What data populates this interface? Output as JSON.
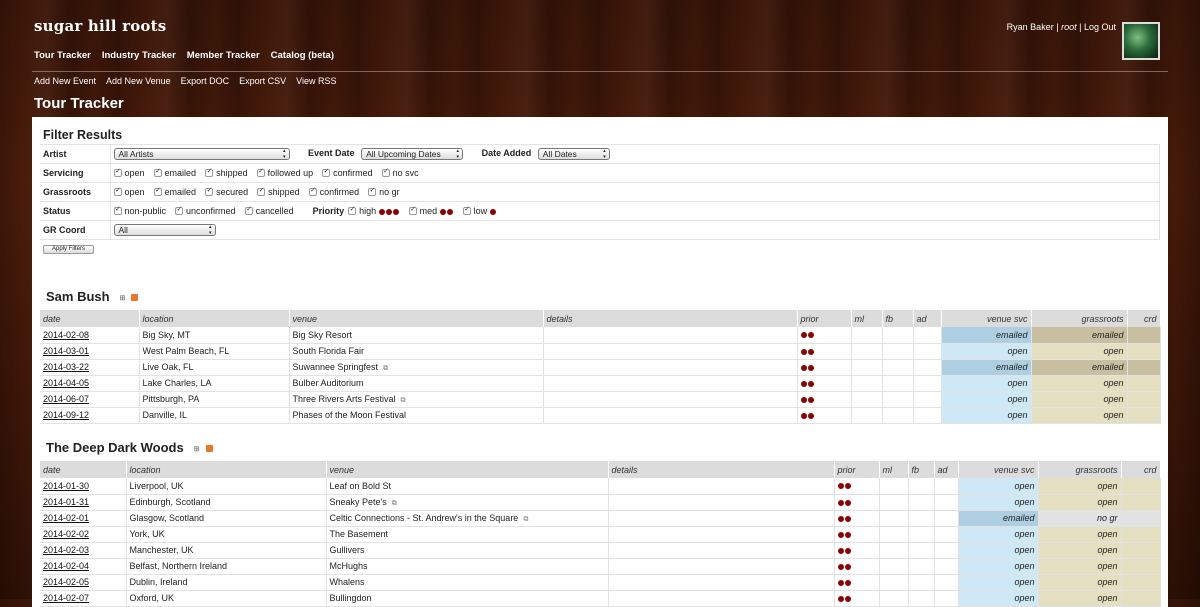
{
  "app": {
    "logo": "sugar hill roots",
    "user": {
      "name": "Ryan Baker",
      "sep1": "|",
      "role": "root",
      "sep2": "|",
      "logout": "Log Out"
    },
    "main_nav": [
      "Tour Tracker",
      "Industry Tracker",
      "Member Tracker",
      "Catalog (beta)"
    ],
    "sub_nav": [
      "Add New Event",
      "Add New Venue",
      "Export DOC",
      "Export CSV",
      "View RSS"
    ],
    "page_title": "Tour Tracker"
  },
  "filters": {
    "title": "Filter Results",
    "artist_label": "Artist",
    "artist_value": "All Artists",
    "event_date_label": "Event Date",
    "event_date_value": "All Upcoming Dates",
    "date_added_label": "Date Added",
    "date_added_value": "All Dates",
    "servicing_label": "Servicing",
    "servicing_options": [
      "open",
      "emailed",
      "shipped",
      "followed up",
      "confirmed",
      "no svc"
    ],
    "grassroots_label": "Grassroots",
    "grassroots_options": [
      "open",
      "emailed",
      "secured",
      "shipped",
      "confirmed",
      "no gr"
    ],
    "status_label": "Status",
    "status_options": [
      "non-public",
      "unconfirmed",
      "cancelled"
    ],
    "priority_label": "Priority",
    "priority_options": [
      {
        "label": "high",
        "dots": 3
      },
      {
        "label": "med",
        "dots": 2
      },
      {
        "label": "low",
        "dots": 1
      }
    ],
    "gr_coord_label": "GR Coord",
    "gr_coord_value": "All",
    "apply_label": "Apply Filters"
  },
  "columns": [
    "date",
    "location",
    "venue",
    "details",
    "prior",
    "ml",
    "fb",
    "ad",
    "venue svc",
    "grassroots",
    "crd"
  ],
  "artists": [
    {
      "name": "Sam Bush",
      "events": [
        {
          "date": "2014-02-08",
          "location": "Big Sky, MT",
          "venue": "Big Sky Resort",
          "link": false,
          "prior": 2,
          "venue_svc": "emailed",
          "grassroots": "emailed"
        },
        {
          "date": "2014-03-01",
          "location": "West Palm Beach, FL",
          "venue": "South Florida Fair",
          "link": false,
          "prior": 2,
          "venue_svc": "open",
          "grassroots": "open"
        },
        {
          "date": "2014-03-22",
          "location": "Live Oak, FL",
          "venue": "Suwannee Springfest",
          "link": true,
          "prior": 2,
          "venue_svc": "emailed",
          "grassroots": "emailed"
        },
        {
          "date": "2014-04-05",
          "location": "Lake Charles, LA",
          "venue": "Bulber Auditorium",
          "link": false,
          "prior": 2,
          "venue_svc": "open",
          "grassroots": "open"
        },
        {
          "date": "2014-06-07",
          "location": "Pittsburgh, PA",
          "venue": "Three Rivers Arts Festival",
          "link": true,
          "prior": 2,
          "venue_svc": "open",
          "grassroots": "open"
        },
        {
          "date": "2014-09-12",
          "location": "Danville, IL",
          "venue": "Phases of the Moon Festival",
          "link": false,
          "prior": 2,
          "venue_svc": "open",
          "grassroots": "open"
        }
      ]
    },
    {
      "name": "The Deep Dark Woods",
      "events": [
        {
          "date": "2014-01-30",
          "location": "Liverpool, UK",
          "venue": "Leaf on Bold St",
          "link": false,
          "prior": 2,
          "venue_svc": "open",
          "grassroots": "open"
        },
        {
          "date": "2014-01-31",
          "location": "Edinburgh, Scotland",
          "venue": "Sneaky Pete's",
          "link": true,
          "prior": 2,
          "venue_svc": "open",
          "grassroots": "open"
        },
        {
          "date": "2014-02-01",
          "location": "Glasgow, Scotland",
          "venue": "Celtic Connections - St. Andrew's in the Square",
          "link": true,
          "prior": 2,
          "venue_svc": "emailed",
          "grassroots": "no gr"
        },
        {
          "date": "2014-02-02",
          "location": "York, UK",
          "venue": "The Basement",
          "link": false,
          "prior": 2,
          "venue_svc": "open",
          "grassroots": "open"
        },
        {
          "date": "2014-02-03",
          "location": "Manchester, UK",
          "venue": "Gullivers",
          "link": false,
          "prior": 2,
          "venue_svc": "open",
          "grassroots": "open"
        },
        {
          "date": "2014-02-04",
          "location": "Belfast, Northern Ireland",
          "venue": "McHughs",
          "link": false,
          "prior": 2,
          "venue_svc": "open",
          "grassroots": "open"
        },
        {
          "date": "2014-02-05",
          "location": "Dublin, Ireland",
          "venue": "Whalens",
          "link": false,
          "prior": 2,
          "venue_svc": "open",
          "grassroots": "open"
        },
        {
          "date": "2014-02-07",
          "location": "Oxford, UK",
          "venue": "Bullingdon",
          "link": false,
          "prior": 2,
          "venue_svc": "open",
          "grassroots": "open"
        }
      ]
    }
  ],
  "colors": {
    "dot": "#8b0000",
    "svc_open": "#cfe8f5",
    "svc_emailed": "#aecfe1",
    "gr_open": "#e4dfc0",
    "gr_emailed": "#c8bea0"
  }
}
